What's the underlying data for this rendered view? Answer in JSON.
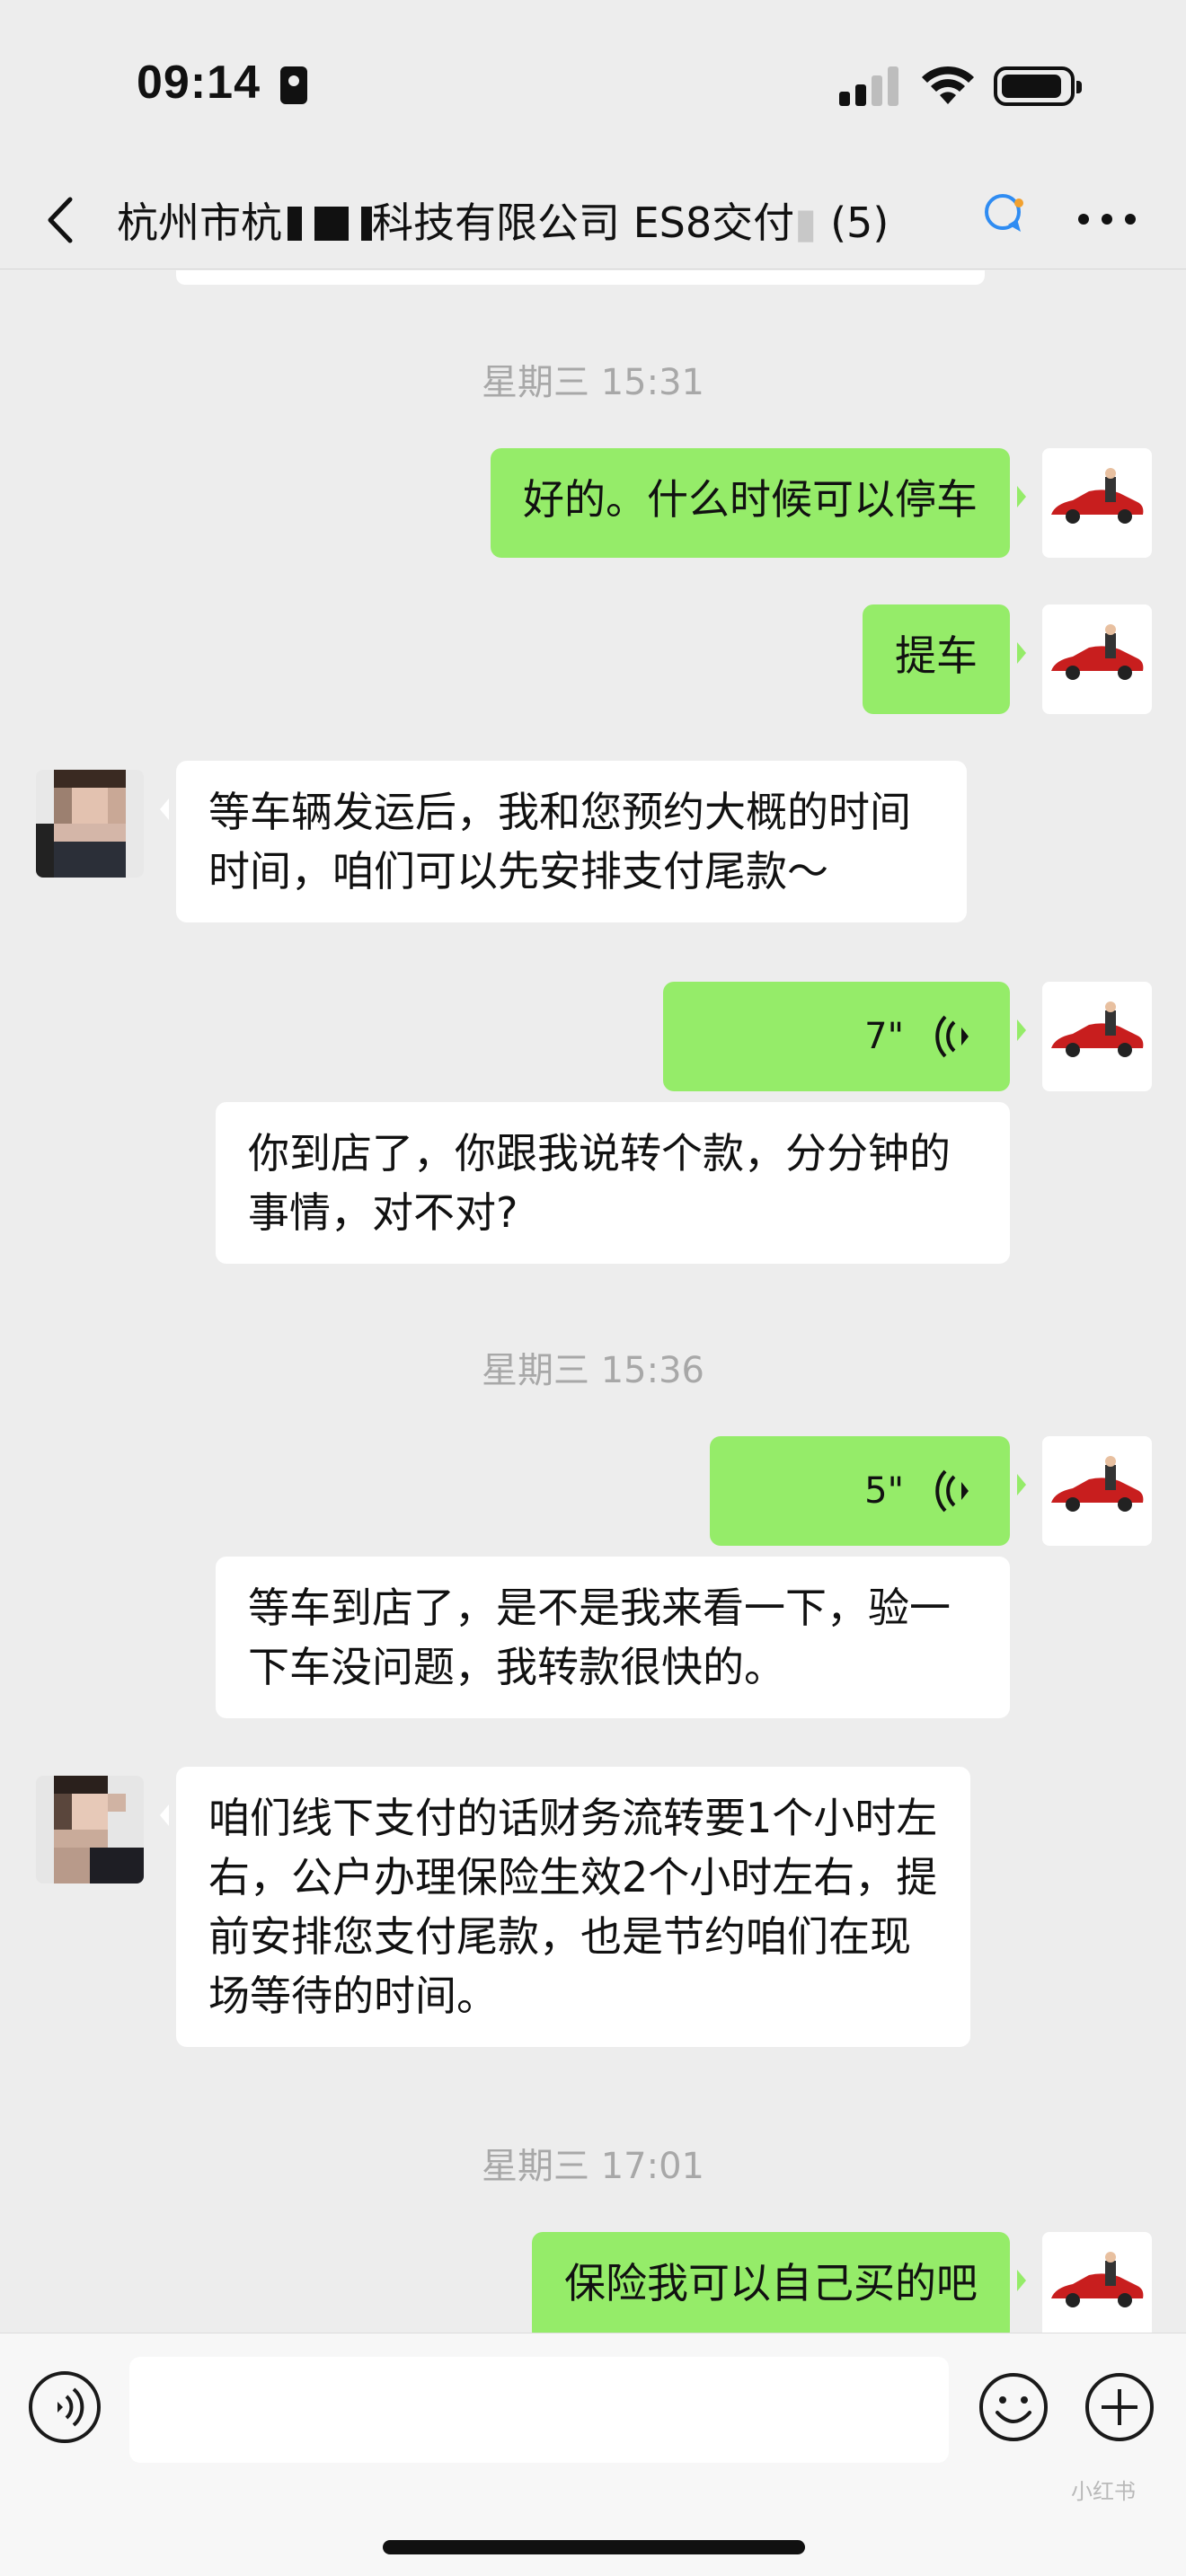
{
  "status_bar": {
    "time": "09:14"
  },
  "nav": {
    "title_part1": "杭州市杭",
    "title_part2": "科技有限公司 ES8交付",
    "member_count": "(5)"
  },
  "messages": [
    {
      "type": "timestamp",
      "text": "星期三 15:31"
    },
    {
      "type": "text",
      "from": "me",
      "text": "好的。什么时候可以停车"
    },
    {
      "type": "text",
      "from": "me",
      "text": "提车"
    },
    {
      "type": "text",
      "from": "them",
      "text": "等车辆发运后，我和您预约大概的时间时间，咱们可以先安排支付尾款～"
    },
    {
      "type": "voice",
      "from": "me",
      "duration": "7\""
    },
    {
      "type": "transcript",
      "text": "你到店了，你跟我说转个款，分分钟的事情，对不对?"
    },
    {
      "type": "timestamp",
      "text": "星期三 15:36"
    },
    {
      "type": "voice",
      "from": "me",
      "duration": "5\""
    },
    {
      "type": "transcript",
      "text": "等车到店了，是不是我来看一下，验一下车没问题，我转款很快的。"
    },
    {
      "type": "text",
      "from": "them",
      "text": "咱们线下支付的话财务流转要1个小时左右，公户办理保险生效2个小时左右，提前安排您支付尾款，也是节约咱们在现场等待的时间。"
    },
    {
      "type": "timestamp",
      "text": "星期三 17:01"
    },
    {
      "type": "text",
      "from": "me",
      "text": "保险我可以自己买的吧"
    }
  ],
  "input_bar": {
    "placeholder": "",
    "watermark": "小红书"
  },
  "colors": {
    "my_bubble": "#95ec69",
    "their_bubble": "#ffffff",
    "background": "#ededed",
    "timestamp": "#a8a8a8"
  },
  "icons": [
    "back-icon",
    "chat-ai-icon",
    "more-icon",
    "voice-wave-icon",
    "voice-input-icon",
    "emoji-icon",
    "plus-icon"
  ]
}
